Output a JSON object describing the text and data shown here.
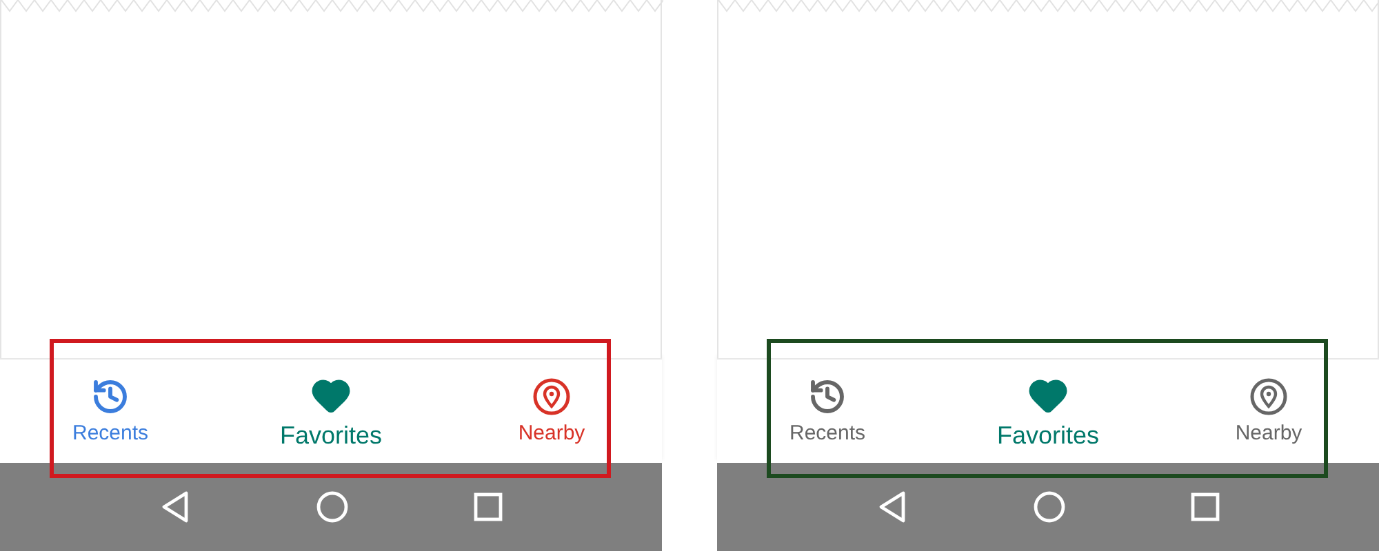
{
  "panels": [
    {
      "color": "#d0191f",
      "tabs": [
        {
          "kind": "history",
          "label": "Recents",
          "color": "#3b7ddd",
          "selected": false
        },
        {
          "kind": "heart",
          "label": "Favorites",
          "color": "#00786a",
          "selected": true
        },
        {
          "kind": "place",
          "label": "Nearby",
          "color": "#d83227",
          "selected": false
        }
      ]
    },
    {
      "color": "#1c4a1f",
      "tabs": [
        {
          "kind": "history",
          "label": "Recents",
          "color": "#666666",
          "selected": false
        },
        {
          "kind": "heart",
          "label": "Favorites",
          "color": "#00786a",
          "selected": true
        },
        {
          "kind": "place",
          "label": "Nearby",
          "color": "#666666",
          "selected": false
        }
      ]
    }
  ]
}
